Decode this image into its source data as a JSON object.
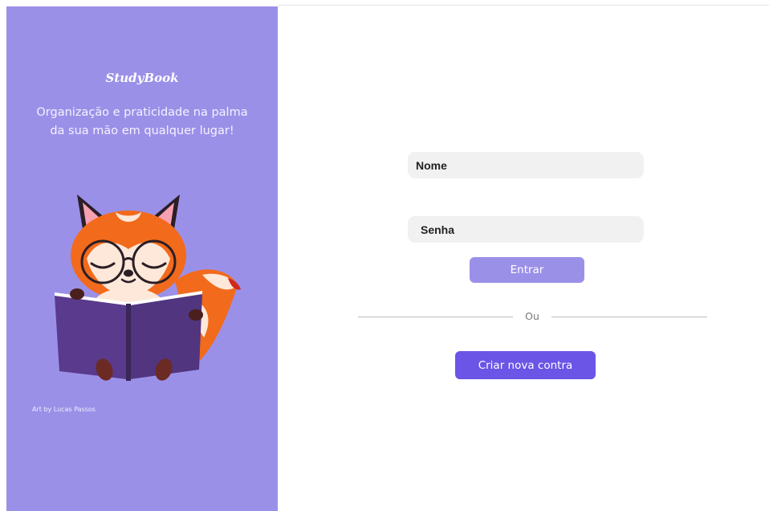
{
  "brand": {
    "name": "StudyBook",
    "tagline": "Organização e praticidade na palma da sua mão em qualquer lugar!",
    "credit": "Art by Lucas Passos"
  },
  "login": {
    "name_field_label": "Nome",
    "password_field_label": "Senha",
    "enter_label": "Entrar",
    "divider_text": "Ou",
    "create_account_label": "Criar nova contra"
  },
  "colors": {
    "panel": "#9b90e8",
    "primary_button": "#6a55e6",
    "input_bg": "#f1f1f1",
    "fox_orange": "#f26a1b",
    "book_purple": "#5a3a8c"
  },
  "icons": {
    "illustration": "fox-reading-book-illustration"
  }
}
